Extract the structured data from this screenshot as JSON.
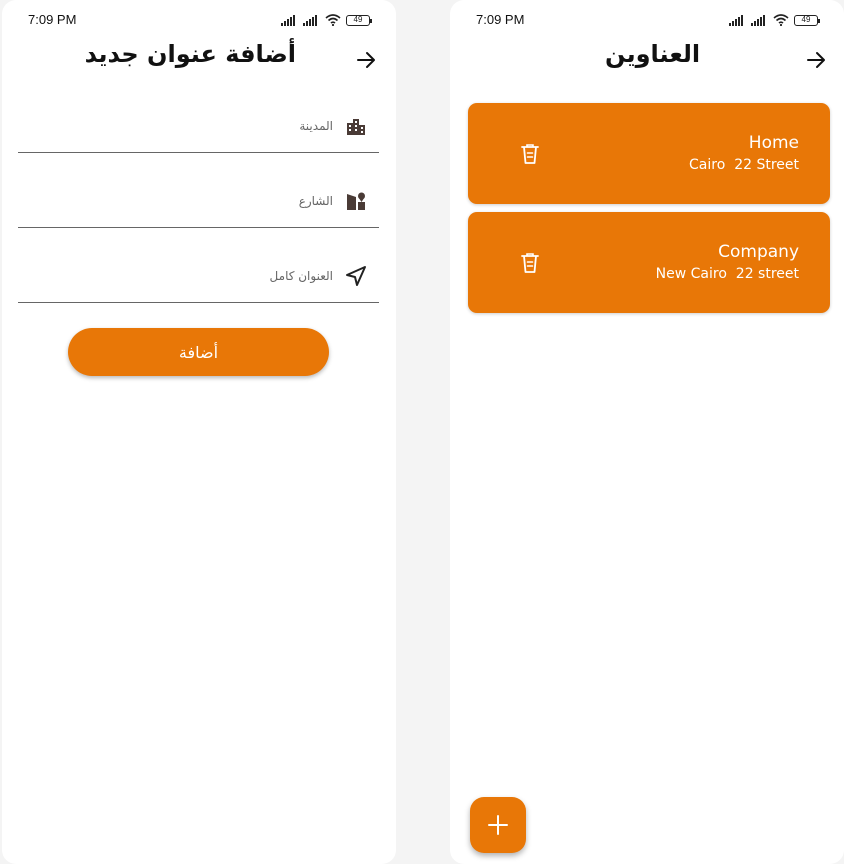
{
  "colors": {
    "accent": "#e87707",
    "text": "#111111",
    "muted": "#666666",
    "white": "#ffffff"
  },
  "status_bar": {
    "time": "7:09 PM",
    "battery": "49"
  },
  "add_screen": {
    "title": "أضافة عنوان جديد",
    "fields": [
      {
        "placeholder": "المدينة",
        "icon": "city-icon"
      },
      {
        "placeholder": "الشارع",
        "icon": "street-icon"
      },
      {
        "placeholder": "العنوان كامل",
        "icon": "navigation-icon"
      }
    ],
    "submit_label": "أضافة"
  },
  "list_screen": {
    "title": "العناوين",
    "addresses": [
      {
        "name": "Home",
        "detail": "Cairo  22 Street"
      },
      {
        "name": "Company",
        "detail": "New Cairo  22 street"
      }
    ]
  }
}
